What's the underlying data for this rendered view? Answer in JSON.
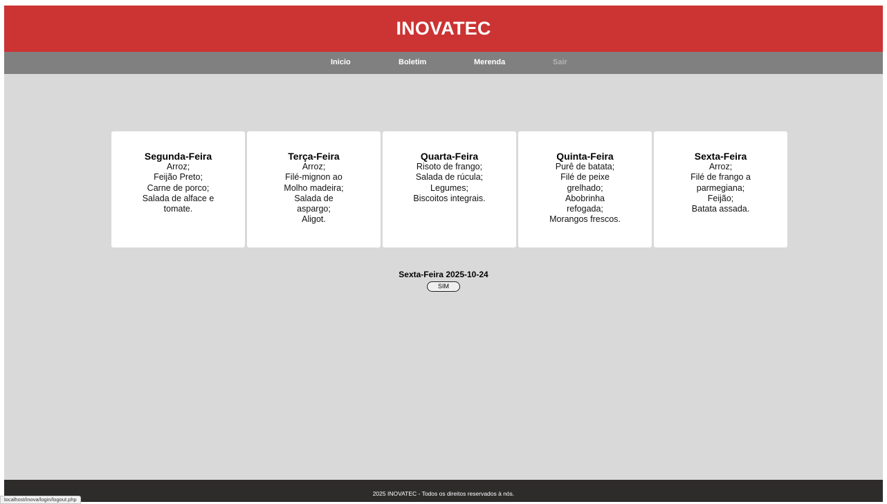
{
  "header": {
    "title": "INOVATEC"
  },
  "nav": {
    "items": [
      {
        "label": "Inicio"
      },
      {
        "label": "Boletim"
      },
      {
        "label": "Merenda"
      },
      {
        "label": "Sair"
      }
    ]
  },
  "menu": {
    "days": [
      {
        "name": "Segunda-Feira",
        "items": [
          "Arroz;",
          "Feijão Preto;",
          "Carne de porco;",
          "Salada de alface e",
          "tomate."
        ]
      },
      {
        "name": "Terça-Feira",
        "items": [
          "Arroz;",
          "Filé-mignon ao",
          "Molho madeira;",
          "Salada de",
          "aspargo;",
          "Aligot."
        ]
      },
      {
        "name": "Quarta-Feira",
        "items": [
          "Risoto de frango;",
          "Salada de rúcula;",
          "Legumes;",
          "Biscoitos integrais."
        ]
      },
      {
        "name": "Quinta-Feira",
        "items": [
          "Purê de batata;",
          "Filé de peixe",
          "grelhado;",
          "Abobrinha",
          "refogada;",
          "Morangos frescos."
        ]
      },
      {
        "name": "Sexta-Feira",
        "items": [
          "Arroz;",
          "Filé de frango a",
          "parmegiana;",
          "Feijão;",
          "Batata assada."
        ]
      }
    ]
  },
  "today": {
    "label": "Sexta-Feira 2025-10-24",
    "button_label": "SIM"
  },
  "footer": {
    "text": "2025 INOVATEC - Todos os direitos reservados à nós."
  },
  "statusbar": {
    "url": "localhost/inova/login/logout.php"
  },
  "colors": {
    "header": "#cc3333",
    "nav": "#808080",
    "background": "#d9d9d9",
    "footer": "#2e2b2b"
  }
}
